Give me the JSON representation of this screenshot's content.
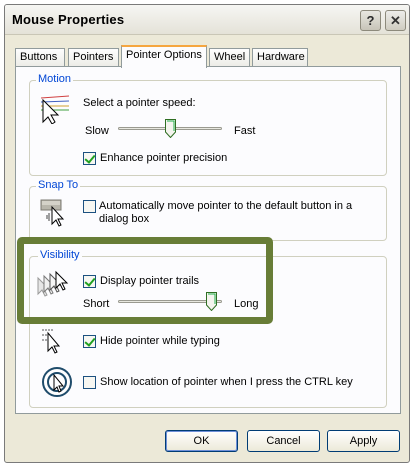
{
  "window": {
    "title": "Mouse Properties"
  },
  "titlebar": {
    "help_glyph": "?",
    "close_glyph": "✕"
  },
  "tabs": [
    {
      "label": "Buttons"
    },
    {
      "label": "Pointers"
    },
    {
      "label": "Pointer Options",
      "selected": true
    },
    {
      "label": "Wheel"
    },
    {
      "label": "Hardware"
    }
  ],
  "motion": {
    "group_label": "Motion",
    "speed_label": "Select a pointer speed:",
    "slow_label": "Slow",
    "fast_label": "Fast",
    "speed_level_fraction": 0.5,
    "enhance_precision_label": "Enhance pointer precision",
    "enhance_precision_checked": true
  },
  "snap_to": {
    "group_label": "Snap To",
    "auto_move_label_line1": "Automatically move pointer to the default button in a",
    "auto_move_label_line2": "dialog box",
    "auto_move_checked": false
  },
  "visibility": {
    "group_label": "Visibility",
    "trails_label": "Display pointer trails",
    "trails_checked": true,
    "short_label": "Short",
    "long_label": "Long",
    "trail_length_fraction": 0.95,
    "hide_while_typing_label": "Hide pointer while typing",
    "hide_while_typing_checked": true,
    "show_location_label": "Show location of pointer when I press the CTRL key",
    "show_location_checked": false
  },
  "buttons": {
    "ok": "OK",
    "cancel": "Cancel",
    "apply": "Apply"
  },
  "colors": {
    "highlight_frame": "#687d37",
    "group_label": "#0046d5",
    "active_tab_accent": "#f5a640",
    "check": "#21a121"
  }
}
